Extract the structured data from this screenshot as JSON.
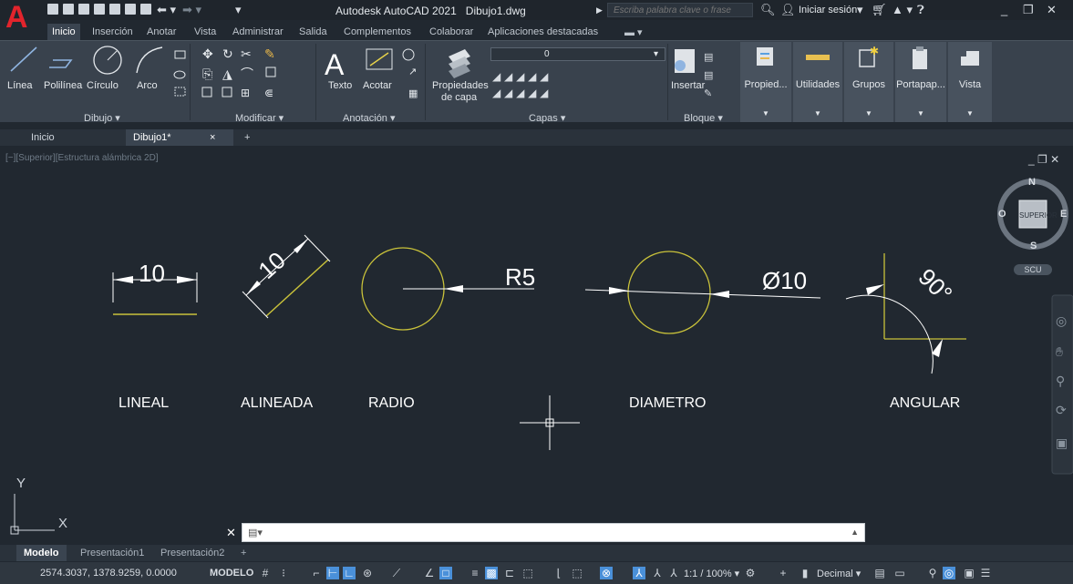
{
  "app": {
    "logo_letter": "A",
    "title": "Autodesk AutoCAD 2021",
    "document_name": "Dibujo1.dwg",
    "search_placeholder": "Escriba palabra clave o frase",
    "login_label": "Iniciar sesión"
  },
  "menu_tabs": [
    "Inicio",
    "Inserción",
    "Anotar",
    "Vista",
    "Administrar",
    "Salida",
    "Complementos",
    "Colaborar",
    "Aplicaciones destacadas"
  ],
  "ribbon": {
    "draw_tools": [
      "Línea",
      "Polilínea",
      "Círculo",
      "Arco"
    ],
    "panels": {
      "draw": "Dibujo",
      "modify": "Modificar",
      "annotation": "Anotación",
      "layers": "Capas",
      "block": "Bloque"
    },
    "annotation_tools": [
      "Texto",
      "Acotar"
    ],
    "layer_props_line1": "Propiedades",
    "layer_props_line2": "de capa",
    "layer_current": "0",
    "insert_label": "Insertar",
    "gray_panels": [
      "Propied...",
      "Utilidades",
      "Grupos",
      "Portapap...",
      "Vista"
    ]
  },
  "doc_tabs": {
    "start": "Inicio",
    "drawing": "Dibujo1*",
    "close_symbol": "×",
    "add_symbol": "+"
  },
  "canvas": {
    "view_label": "[−][Superior][Estructura alámbrica 2D]",
    "dimensions": {
      "linear": "10",
      "aligned": "10",
      "radius": "R5",
      "diameter": "Ø10",
      "angular": "90°"
    },
    "captions": [
      "LINEAL",
      "ALINEADA",
      "RADIO",
      "DIAMETRO",
      "ANGULAR"
    ],
    "viewcube": {
      "n": "N",
      "s": "S",
      "e": "E",
      "o": "O",
      "face": "SUPERIOR",
      "ucs": "SCU"
    },
    "ucs_y": "Y",
    "ucs_x": "X"
  },
  "layout_tabs": [
    "Modelo",
    "Presentación1",
    "Presentación2"
  ],
  "status": {
    "coords": "2574.3037, 1378.9259, 0.0000",
    "mode": "MODELO",
    "scale": "1:1 / 100%",
    "units": "Decimal"
  },
  "colors": {
    "accent_yellow": "#c9c23a",
    "canvas_bg": "#212830",
    "logo_red": "#e2242c"
  }
}
